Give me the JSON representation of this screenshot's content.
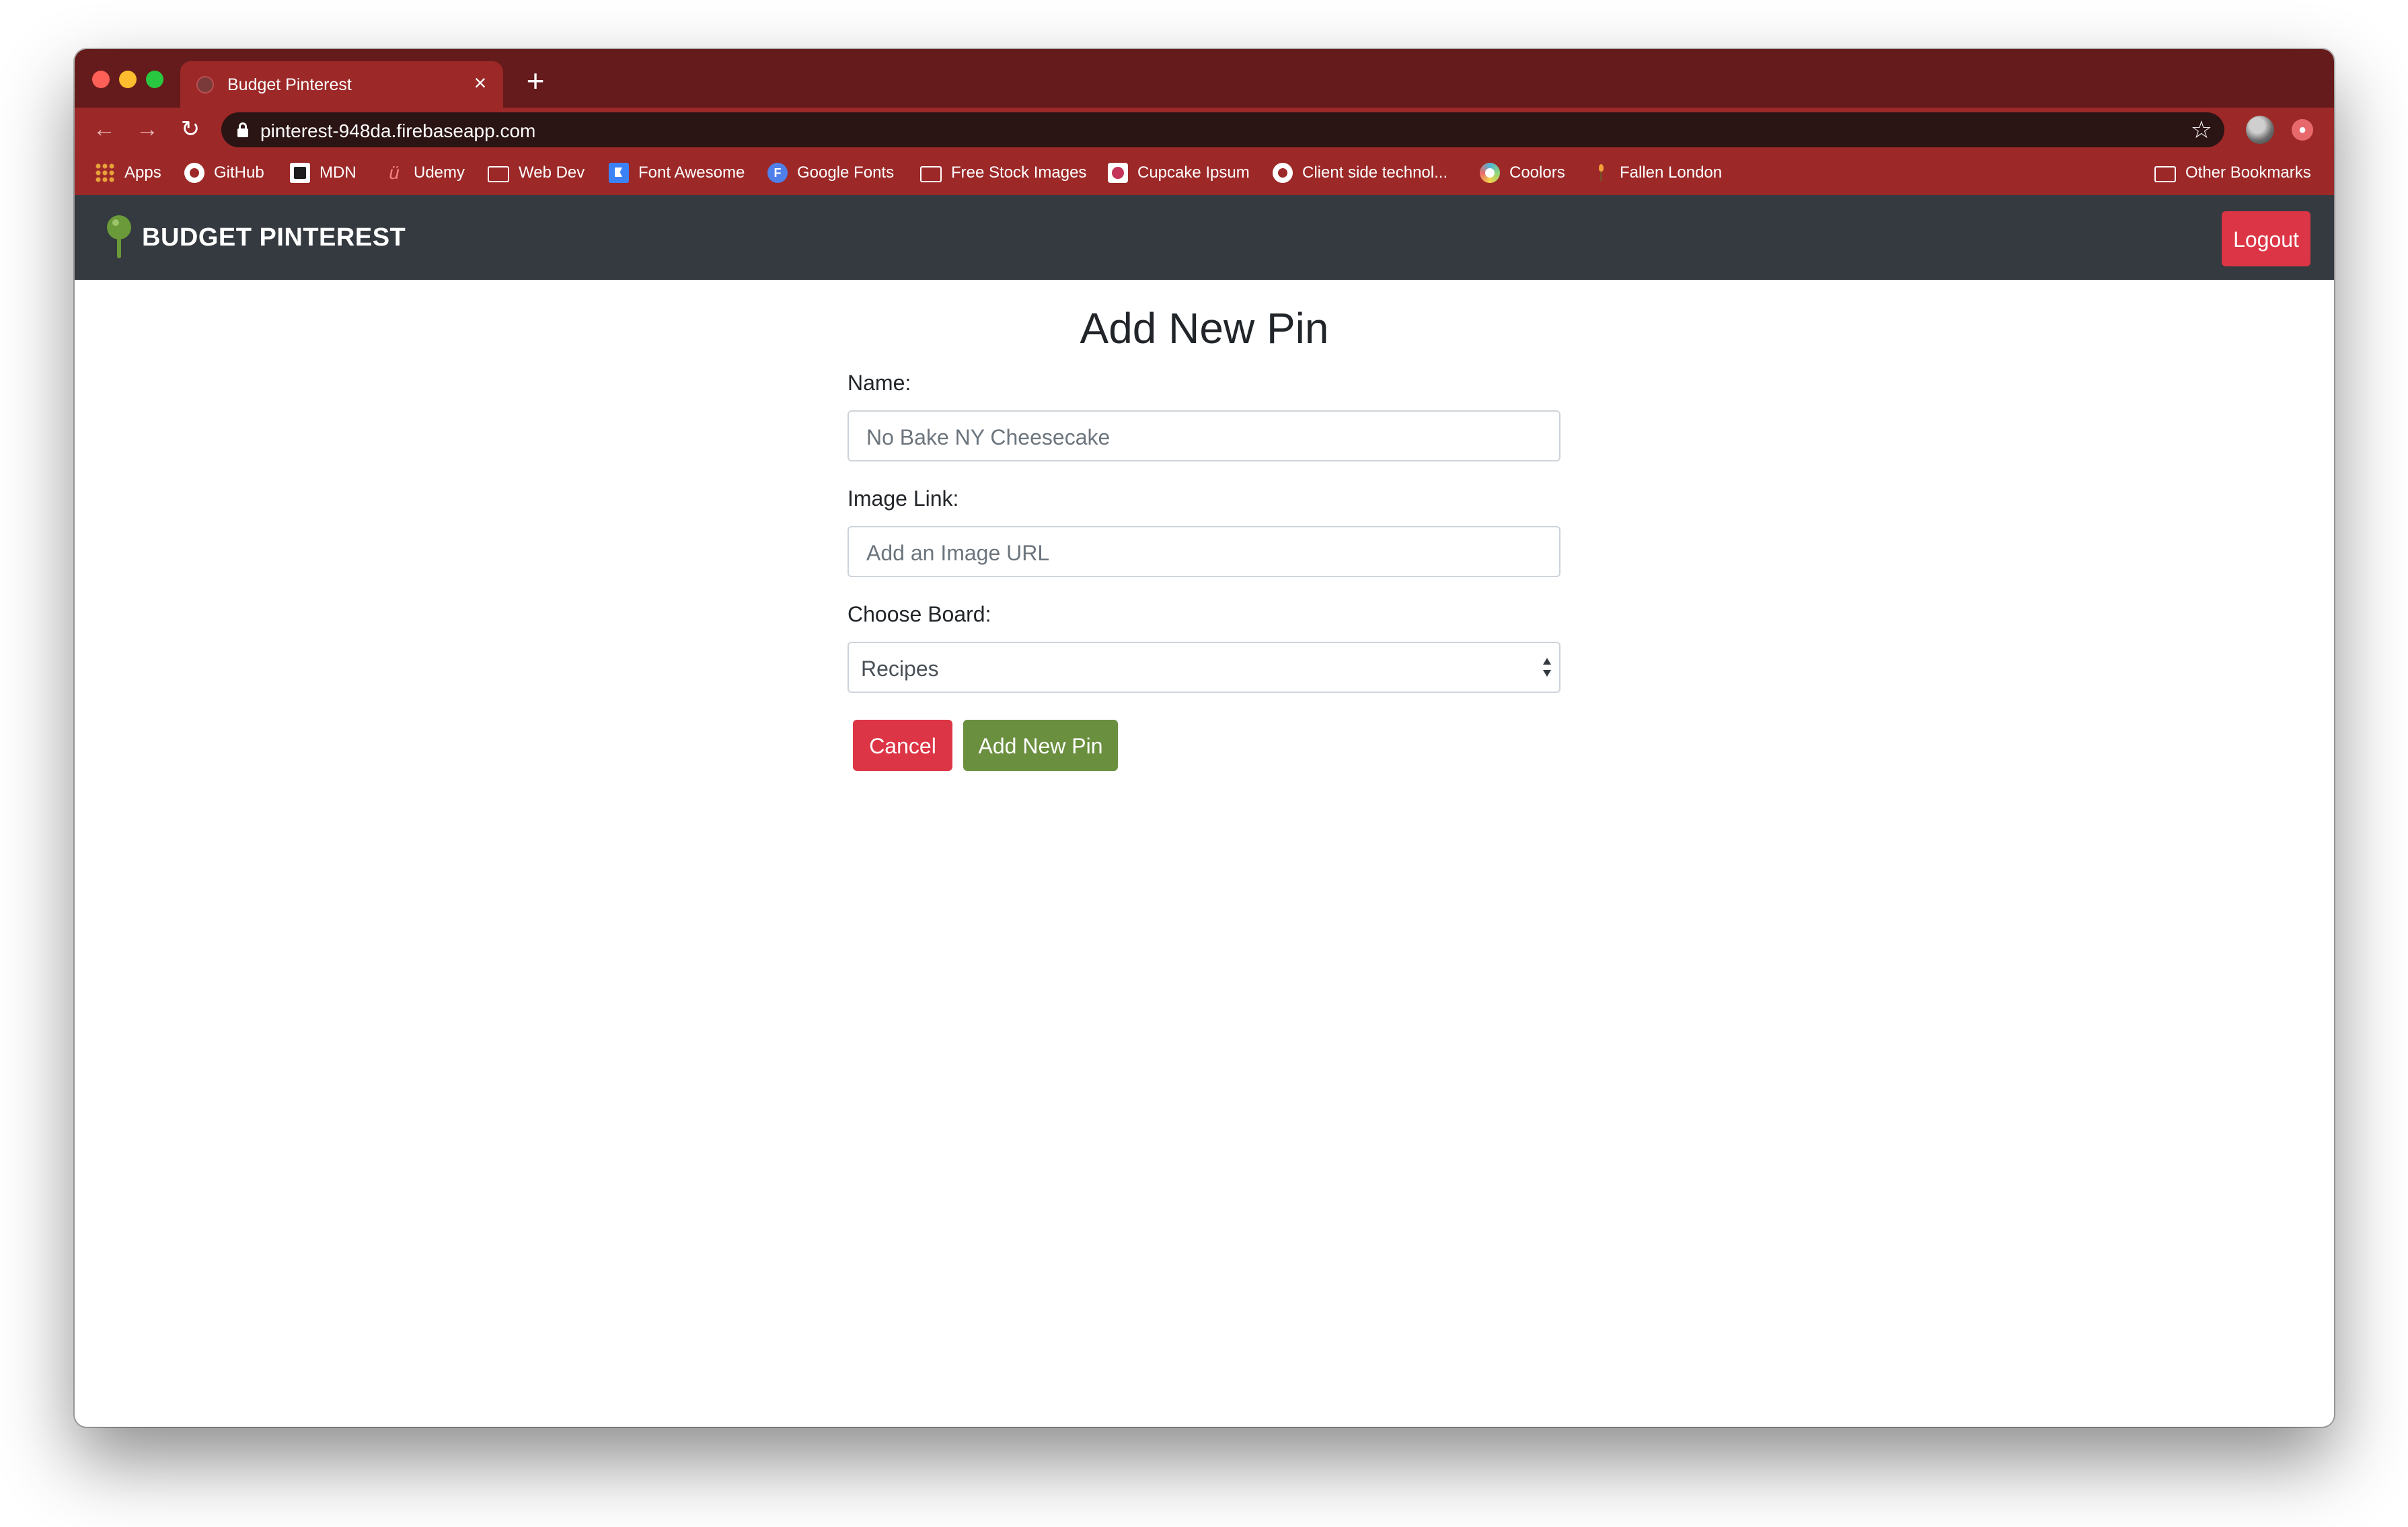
{
  "browser": {
    "tab_title": "Budget Pinterest",
    "tab_close": "×",
    "new_tab": "+",
    "url": "pinterest-948da.firebaseapp.com",
    "nav": {
      "back": "←",
      "forward": "→",
      "reload": "↻",
      "star": "☆"
    },
    "bookmarks": [
      {
        "label": "Apps",
        "icon": "apps-grid-icon"
      },
      {
        "label": "GitHub",
        "icon": "github-icon"
      },
      {
        "label": "MDN",
        "icon": "mdn-icon"
      },
      {
        "label": "Udemy",
        "icon": "udemy-icon"
      },
      {
        "label": "Web Dev",
        "icon": "folder-icon"
      },
      {
        "label": "Font Awesome",
        "icon": "font-awesome-flag-icon"
      },
      {
        "label": "Google Fonts",
        "icon": "google-fonts-icon"
      },
      {
        "label": "Free Stock Images",
        "icon": "folder-icon"
      },
      {
        "label": "Cupcake Ipsum",
        "icon": "cupcake-icon"
      },
      {
        "label": "Client side technol...",
        "icon": "github-icon"
      },
      {
        "label": "Coolors",
        "icon": "coolors-icon"
      },
      {
        "label": "Fallen London",
        "icon": "candle-icon"
      },
      {
        "label": "Other Bookmarks",
        "icon": "folder-icon"
      }
    ],
    "google_fonts_glyph": "F",
    "udemy_glyph": "ü"
  },
  "navbar": {
    "brand": "BUDGET PINTEREST",
    "logout": "Logout"
  },
  "form": {
    "title": "Add New Pin",
    "name_label": "Name:",
    "name_placeholder": "No Bake NY Cheesecake",
    "image_label": "Image Link:",
    "image_placeholder": "Add an Image URL",
    "board_label": "Choose Board:",
    "board_selected": "Recipes",
    "cancel": "Cancel",
    "submit": "Add New Pin"
  },
  "colors": {
    "tab_strip": "#651b1b",
    "browser_chrome": "#9c2828",
    "navbar": "#343a40",
    "danger": "#dc3545",
    "accent_green": "#6a8f3f"
  }
}
